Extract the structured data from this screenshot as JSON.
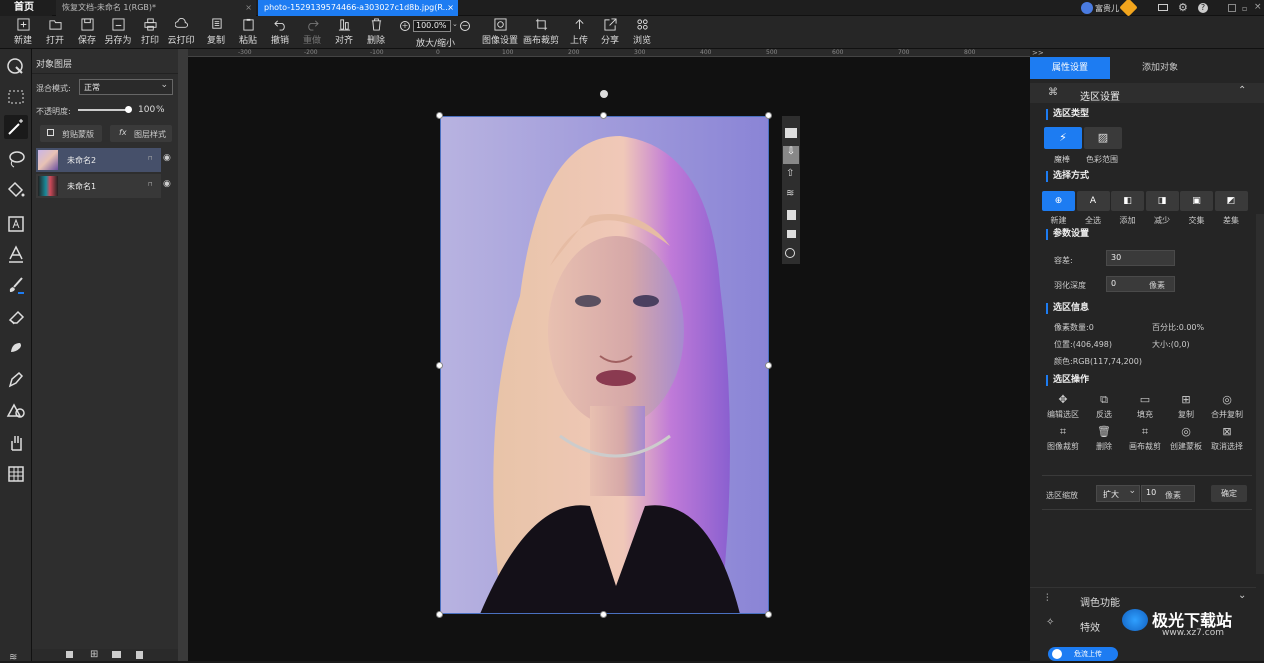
{
  "tabs": {
    "home": "首页",
    "tab1": "恢复文档-未命名 1(RGB)*",
    "tab2": "photo-1529139574466-a303027c1d8b.jpg(R..."
  },
  "titlebar": {
    "user": "富贵儿"
  },
  "toolbar": {
    "new": "新建",
    "open": "打开",
    "save": "保存",
    "save_as": "另存为",
    "print": "打印",
    "cloud_print": "云打印",
    "copy": "复制",
    "paste": "粘贴",
    "undo": "撤销",
    "redo": "重做",
    "align": "对齐",
    "delete": "删除",
    "zoom_value": "100.0%",
    "zoom_label": "放大/缩小",
    "image_settings": "图像设置",
    "canvas_crop": "画布裁剪",
    "upload": "上传",
    "share": "分享",
    "browse": "浏览"
  },
  "ruler": {
    "ticks": [
      "-300",
      "-200",
      "-100",
      "0",
      "100",
      "200",
      "300",
      "400",
      "500",
      "600",
      "700",
      "800",
      "900"
    ]
  },
  "layers": {
    "title": "对象图层",
    "blend_label": "混合模式:",
    "blend_value": "正常",
    "opacity_label": "不透明度:",
    "opacity_value": "100",
    "opacity_unit": "%",
    "opacity_level": 1.0,
    "clipboard_btn": "剪贴蒙版",
    "style_btn": "图层样式",
    "items": [
      "未命名2",
      "未命名1"
    ]
  },
  "right": {
    "tab_props": "属性设置",
    "tab_add": "添加对象",
    "header": "选区设置",
    "type_title": "选区类型",
    "type_magic": "魔棒",
    "type_color": "色彩范围",
    "mode_title": "选择方式",
    "modes": [
      "新建",
      "全选",
      "添加",
      "减少",
      "交集",
      "差集"
    ],
    "param_title": "参数设置",
    "tolerance_label": "容差:",
    "tolerance_value": "30",
    "feather_label": "羽化深度",
    "feather_value": "0",
    "feather_unit": "像素",
    "info_title": "选区信息",
    "pixel_count": "像素数量:0",
    "percent": "百分比:0.00%",
    "position": "位置:(406,498)",
    "size": "大小:(0,0)",
    "color": "颜色:RGB(117,74,200)",
    "ops_title": "选区操作",
    "ops_row1": [
      "编辑选区",
      "反选",
      "填充",
      "复制",
      "合并复制"
    ],
    "ops_row2": [
      "图像裁剪",
      "删除",
      "画布裁剪",
      "创建蒙板",
      "取消选择"
    ],
    "zoom_label": "选区缩放",
    "zoom_mode": "扩大",
    "zoom_value": "10",
    "zoom_unit": "像素",
    "confirm": "确定",
    "adjust": "调色功能",
    "effects": "特效",
    "watermark": "极光下载站",
    "watermark_url": "www.xz7.com",
    "bottom_btn": "危流上传"
  },
  "colors": {
    "accent": "#1d7cf2",
    "bg": "#252525"
  }
}
